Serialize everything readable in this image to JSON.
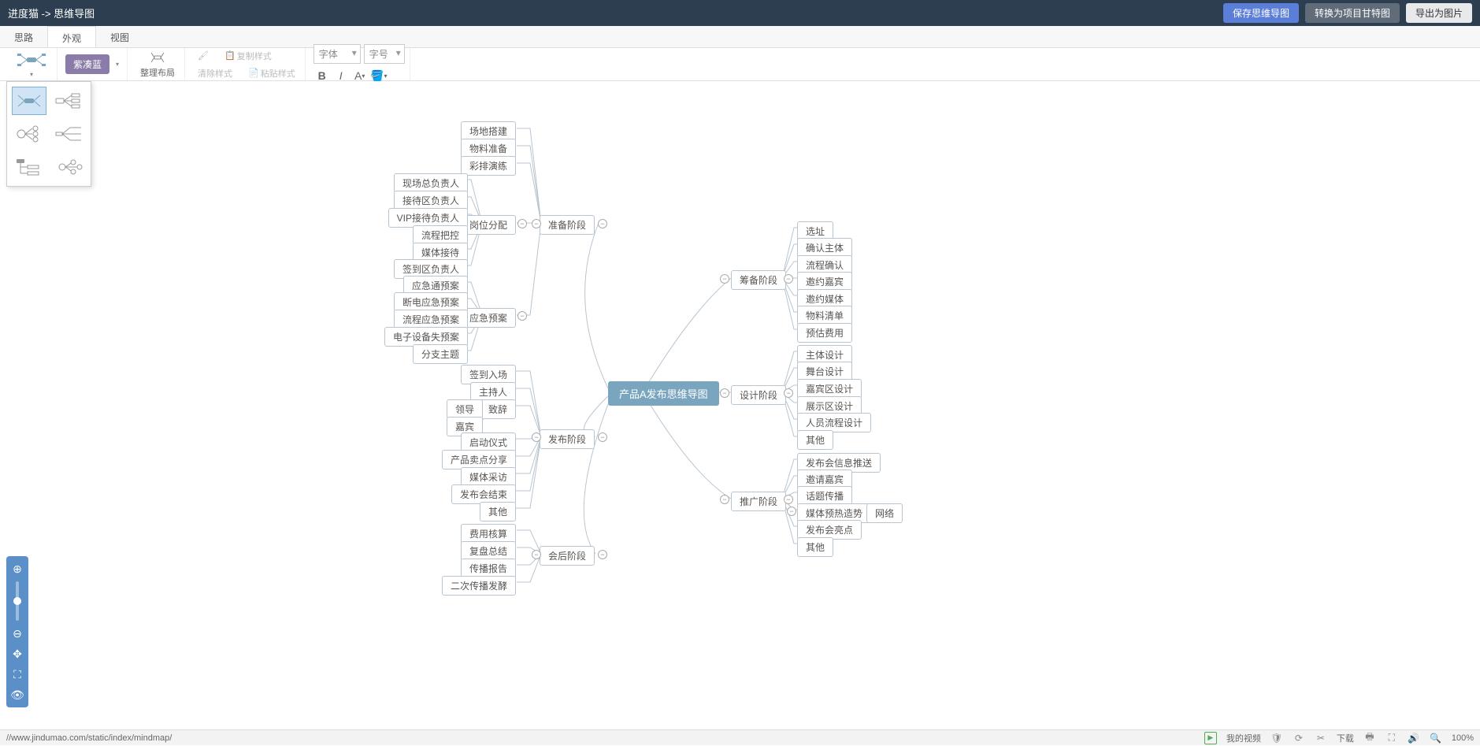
{
  "header": {
    "app_title": "进度猫 -> 思维导图",
    "btn_save": "保存思维导图",
    "btn_convert": "转换为项目甘特图",
    "btn_export": "导出为图片"
  },
  "tabs": [
    {
      "label": "思路",
      "active": false
    },
    {
      "label": "外观",
      "active": true
    },
    {
      "label": "视图",
      "active": false
    }
  ],
  "toolbar": {
    "theme_label": "紫凑蓝",
    "arrange_label": "整理布局",
    "clear_style": "清除样式",
    "copy_style": "复制样式",
    "paste_style": "粘贴样式",
    "font_placeholder": "字体",
    "fontsize_placeholder": "字号"
  },
  "mindmap": {
    "root": "产品A发布思维导图",
    "left": [
      {
        "label": "准备阶段",
        "children": [
          {
            "label": "场地搭建"
          },
          {
            "label": "物料准备"
          },
          {
            "label": "彩排演练"
          },
          {
            "label": "岗位分配",
            "children": [
              {
                "label": "现场总负责人"
              },
              {
                "label": "接待区负责人"
              },
              {
                "label": "VIP接待负责人"
              },
              {
                "label": "流程把控"
              },
              {
                "label": "媒体接待"
              },
              {
                "label": "签到区负责人"
              }
            ]
          },
          {
            "label": "应急预案",
            "children": [
              {
                "label": "应急通预案"
              },
              {
                "label": "断电应急预案"
              },
              {
                "label": "流程应急预案"
              },
              {
                "label": "电子设备失预案"
              },
              {
                "label": "分支主题"
              }
            ]
          }
        ]
      },
      {
        "label": "发布阶段",
        "children": [
          {
            "label": "签到入场"
          },
          {
            "label": "主持人"
          },
          {
            "label": "致辞",
            "children": [
              {
                "label": "领导"
              },
              {
                "label": "嘉宾"
              }
            ]
          },
          {
            "label": "启动仪式"
          },
          {
            "label": "产品卖点分享"
          },
          {
            "label": "媒体采访"
          },
          {
            "label": "发布会结束"
          },
          {
            "label": "其他"
          }
        ]
      },
      {
        "label": "会后阶段",
        "children": [
          {
            "label": "费用核算"
          },
          {
            "label": "复盘总结"
          },
          {
            "label": "传播报告"
          },
          {
            "label": "二次传播发酵"
          }
        ]
      }
    ],
    "right": [
      {
        "label": "筹备阶段",
        "children": [
          {
            "label": "选址"
          },
          {
            "label": "确认主体"
          },
          {
            "label": "流程确认"
          },
          {
            "label": "邀约嘉宾"
          },
          {
            "label": "邀约媒体"
          },
          {
            "label": "物料清单"
          },
          {
            "label": "预估费用"
          }
        ]
      },
      {
        "label": "设计阶段",
        "children": [
          {
            "label": "主体设计"
          },
          {
            "label": "舞台设计"
          },
          {
            "label": "嘉宾区设计"
          },
          {
            "label": "展示区设计"
          },
          {
            "label": "人员流程设计"
          },
          {
            "label": "其他"
          }
        ]
      },
      {
        "label": "推广阶段",
        "children": [
          {
            "label": "发布会信息推送"
          },
          {
            "label": "邀请嘉宾"
          },
          {
            "label": "话题传播"
          },
          {
            "label": "媒体预热造势",
            "children": [
              {
                "label": "网络"
              }
            ]
          },
          {
            "label": "发布会亮点"
          },
          {
            "label": "其他"
          }
        ]
      }
    ]
  },
  "status": {
    "url": "//www.jindumao.com/static/index/mindmap/",
    "my_video": "我的视频",
    "download": "下载",
    "zoom": "100%"
  }
}
